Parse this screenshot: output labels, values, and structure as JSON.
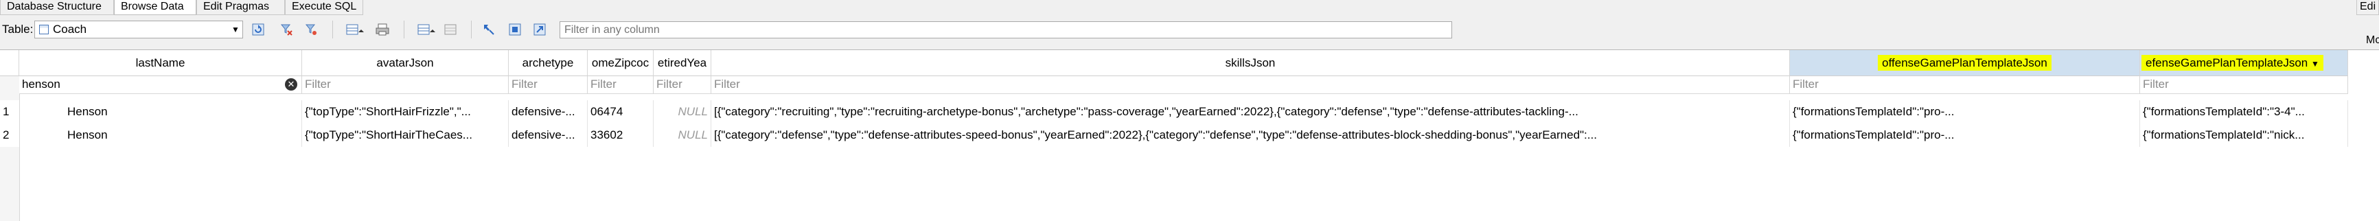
{
  "tabs": [
    {
      "label": "Database Structure",
      "active": false
    },
    {
      "label": "Browse Data",
      "active": true
    },
    {
      "label": "Edit Pragmas",
      "active": false
    },
    {
      "label": "Execute SQL",
      "active": false
    }
  ],
  "right_tab_label": "Edi",
  "right_side_label": "Mc",
  "toolbar": {
    "table_label": "Table:",
    "table_value": "Coach",
    "filter_placeholder": "Filter in any column",
    "icons": [
      "refresh-icon",
      "clear-filters-icon",
      "save-table-icon",
      "print-icon",
      "insert-record-icon",
      "delete-record-icon",
      "find-icon",
      "find-replace-icon",
      "export-icon"
    ]
  },
  "grid": {
    "columns": [
      {
        "label": "lastName",
        "filter_value": "henson",
        "filter_placeholder": "",
        "highlighted": false
      },
      {
        "label": "avatarJson",
        "filter_value": "",
        "filter_placeholder": "Filter",
        "highlighted": false
      },
      {
        "label": "archetype",
        "filter_value": "",
        "filter_placeholder": "Filter",
        "highlighted": false
      },
      {
        "label": "omeZipcoc",
        "filter_value": "",
        "filter_placeholder": "Filter",
        "highlighted": false
      },
      {
        "label": "etiredYea",
        "filter_value": "",
        "filter_placeholder": "Filter",
        "highlighted": false
      },
      {
        "label": "skillsJson",
        "filter_value": "",
        "filter_placeholder": "Filter",
        "highlighted": false
      },
      {
        "label": "offenseGamePlanTemplateJson",
        "filter_value": "",
        "filter_placeholder": "Filter",
        "highlighted": true
      },
      {
        "label": "efenseGamePlanTemplateJson",
        "filter_value": "",
        "filter_placeholder": "Filter",
        "highlighted": true,
        "sort_indicator": "▼"
      }
    ],
    "rows": [
      {
        "num": "1",
        "cells": [
          "Henson",
          "{\"topType\":\"ShortHairFrizzle\",\"...",
          "defensive-...",
          "06474",
          "NULL",
          "[{\"category\":\"recruiting\",\"type\":\"recruiting-archetype-bonus\",\"archetype\":\"pass-coverage\",\"yearEarned\":2022},{\"category\":\"defense\",\"type\":\"defense-attributes-tackling-...",
          "{\"formationsTemplateId\":\"pro-...",
          "{\"formationsTemplateId\":\"3-4\"..."
        ]
      },
      {
        "num": "2",
        "cells": [
          "Henson",
          "{\"topType\":\"ShortHairTheCaes...",
          "defensive-...",
          "33602",
          "NULL",
          "[{\"category\":\"defense\",\"type\":\"defense-attributes-speed-bonus\",\"yearEarned\":2022},{\"category\":\"defense\",\"type\":\"defense-attributes-block-shedding-bonus\",\"yearEarned\":...",
          "{\"formationsTemplateId\":\"pro-...",
          "{\"formationsTemplateId\":\"nick..."
        ]
      }
    ]
  },
  "colors": {
    "highlight": "#f4ff00",
    "selected_header": "#cfe0f0"
  }
}
